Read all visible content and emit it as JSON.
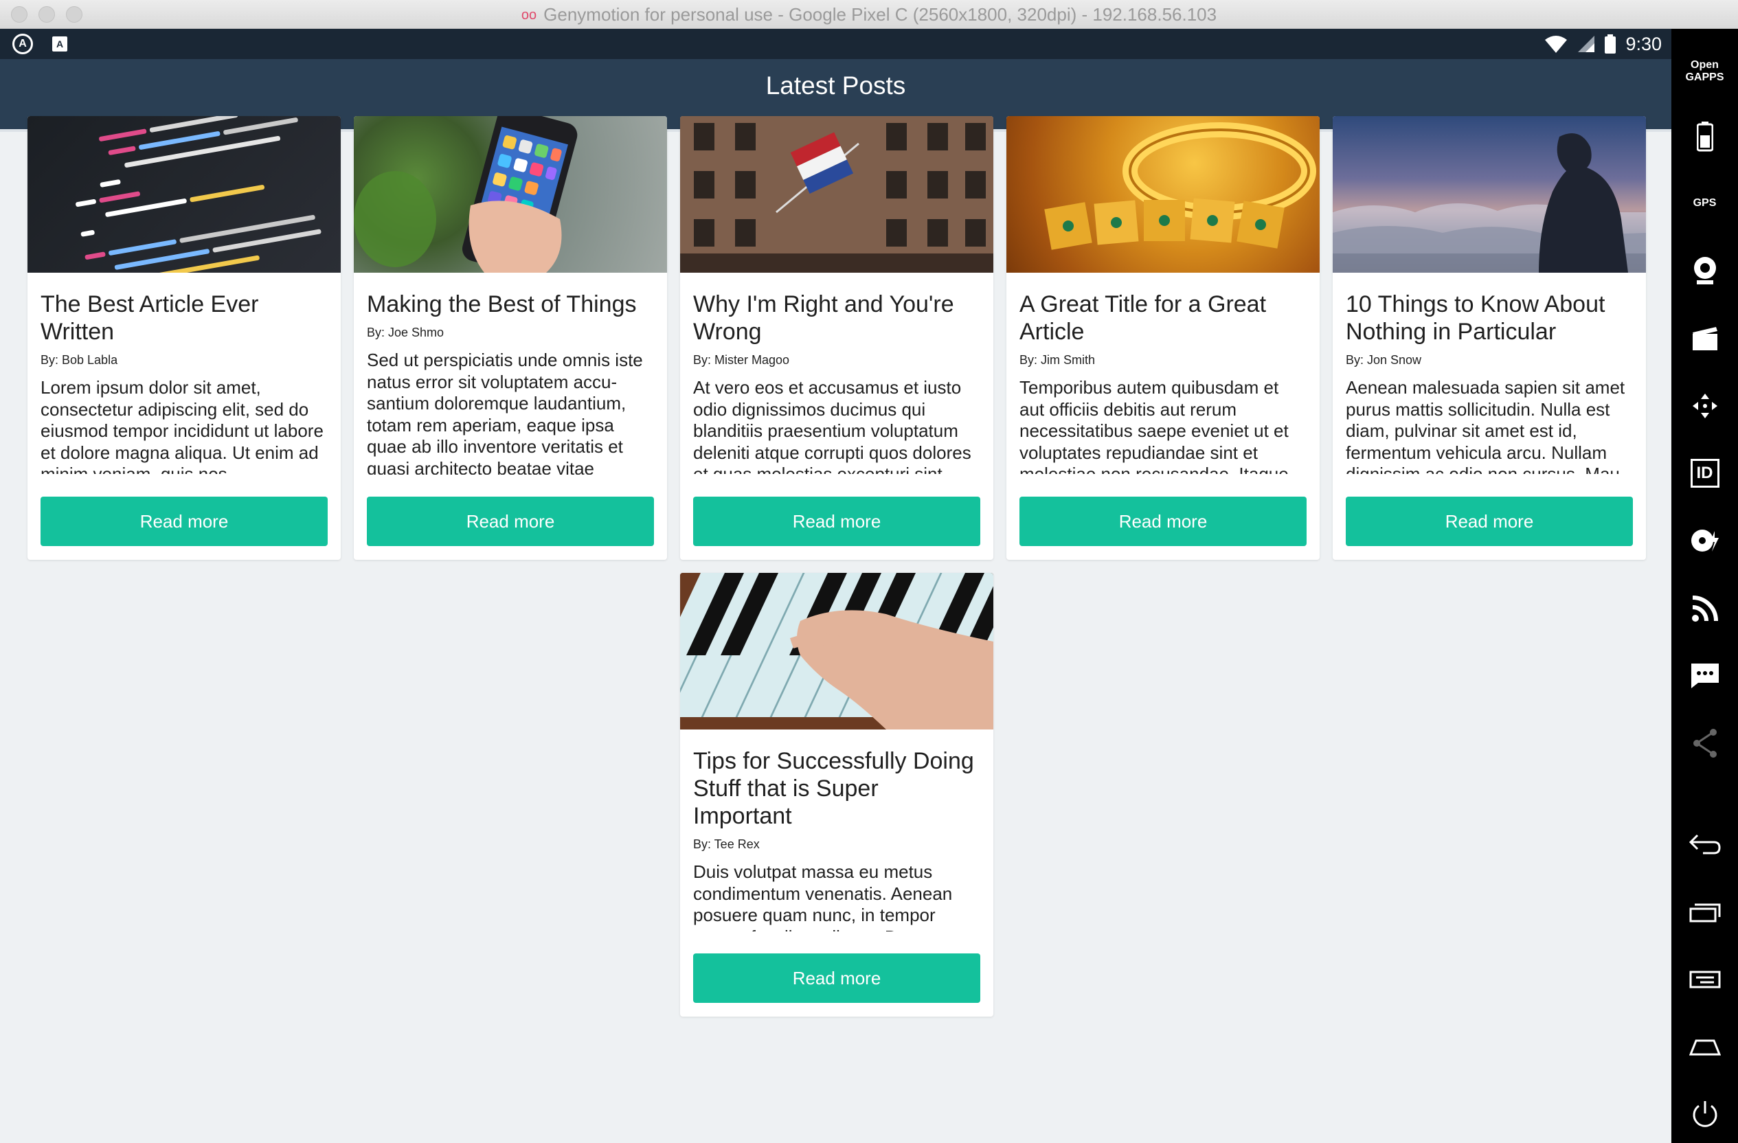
{
  "window": {
    "title": "Genymotion for personal use - Google Pixel C (2560x1800, 320dpi) - 192.168.56.103",
    "logo_glyph": "oo"
  },
  "statusbar": {
    "time": "9:30",
    "left_icons": [
      "android-studio-icon",
      "app-notification-icon"
    ],
    "left_glyphs": [
      "A",
      "A"
    ],
    "right_icons": [
      "wifi-icon",
      "signal-icon",
      "battery-icon"
    ]
  },
  "appbar": {
    "title": "Latest Posts"
  },
  "colors": {
    "accent": "#14c19c",
    "appbar": "#2a3f54",
    "statusbar": "#1a2735",
    "background": "#eef1f3"
  },
  "posts": [
    {
      "title": "The Best Article Ever Written",
      "author": "By: Bob Labla",
      "excerpt": "Lorem ipsum dolor sit amet, consectetur adipiscing elit, sed do eiusmod tempor incididunt ut labore et dolore magna aliqua. Ut enim ad minim veniam, quis nos-",
      "button": "Read more",
      "image": "code-screen-photo"
    },
    {
      "title": "Making the Best of Things",
      "author": "By: Joe Shmo",
      "excerpt": "Sed ut perspiciatis unde omnis iste natus error sit voluptatem accu-santium doloremque laudantium, totam rem aperiam, eaque ipsa quae ab illo inventore veritatis et quasi architecto beatae vitae",
      "button": "Read more",
      "image": "hand-holding-phone-photo"
    },
    {
      "title": "Why I'm Right and You're Wrong",
      "author": "By: Mister Magoo",
      "excerpt": "At vero eos et accusamus et iusto odio dignissimos ducimus qui blanditiis praesentium voluptatum deleniti atque corrupti quos dolores et quas molestias excepturi sint",
      "button": "Read more",
      "image": "building-with-flag-photo"
    },
    {
      "title": "A Great Title for a Great Article",
      "author": "By: Jim Smith",
      "excerpt": "Temporibus autem quibusdam et aut officiis debitis aut rerum necessitatibus saepe eveniet ut et voluptates repudiandae sint et molestiae non recusandae. Itaque",
      "button": "Read more",
      "image": "gold-jewelry-photo"
    },
    {
      "title": "10 Things to Know About Nothing in Particular",
      "author": "By: Jon Snow",
      "excerpt": "Aenean malesuada sapien sit amet purus mattis sollicitudin. Nulla est diam, pulvinar sit amet est id, fermentum vehicula arcu. Nullam dignissim ac odio non cursus. Mau-",
      "button": "Read more",
      "image": "person-above-clouds-photo"
    },
    {
      "title": "Tips for Successfully Doing Stuff that is Super Important",
      "author": "By: Tee Rex",
      "excerpt": "Duis volutpat massa eu metus condimentum venenatis. Aenean posuere quam nunc, in tempor massa faucibus aliquet. Donec et",
      "button": "Read more",
      "image": "hand-on-piano-photo"
    }
  ],
  "genymotion_sidebar": {
    "items": [
      {
        "name": "open-gapps-icon",
        "label": "Open GAPPS"
      },
      {
        "name": "battery-widget-icon",
        "label": ""
      },
      {
        "name": "gps-widget-icon",
        "label": "GPS"
      },
      {
        "name": "webcam-widget-icon",
        "label": ""
      },
      {
        "name": "screencast-widget-icon",
        "label": ""
      },
      {
        "name": "remote-control-icon",
        "label": ""
      },
      {
        "name": "identifiers-widget-icon",
        "label": "ID"
      },
      {
        "name": "disk-io-widget-icon",
        "label": ""
      },
      {
        "name": "network-widget-icon",
        "label": ""
      },
      {
        "name": "sms-widget-icon",
        "label": ""
      },
      {
        "name": "share-icon",
        "label": ""
      },
      {
        "name": "back-button-icon",
        "label": ""
      },
      {
        "name": "recent-apps-icon",
        "label": ""
      },
      {
        "name": "menu-icon",
        "label": ""
      },
      {
        "name": "home-icon",
        "label": ""
      },
      {
        "name": "power-icon",
        "label": ""
      }
    ]
  }
}
